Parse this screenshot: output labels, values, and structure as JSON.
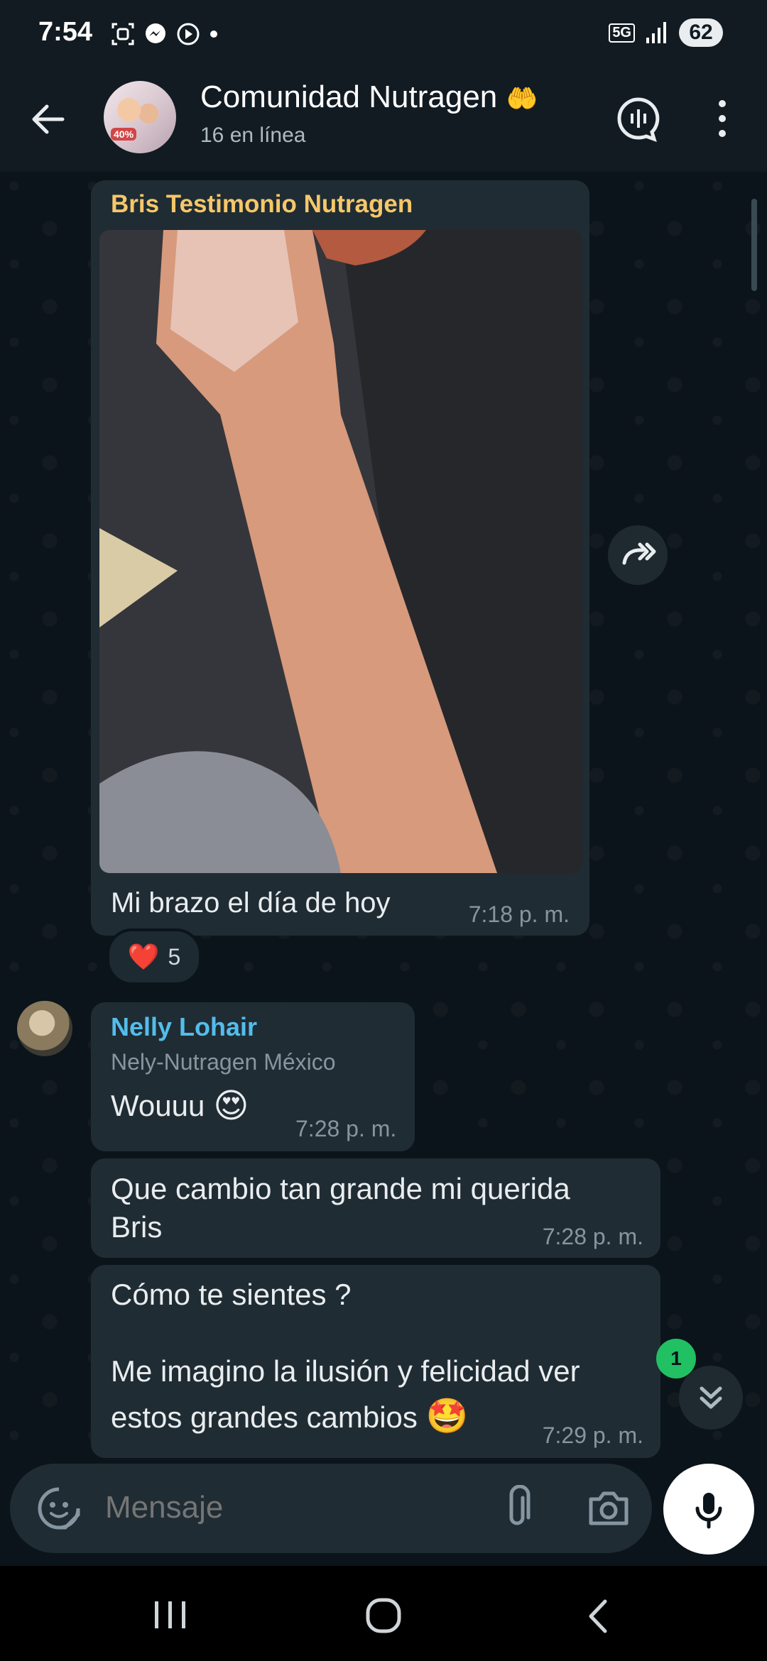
{
  "status_bar": {
    "time": "7:54",
    "network": "5G",
    "battery": "62"
  },
  "header": {
    "title": "Comunidad Nutragen",
    "title_emoji": "🤲",
    "subtitle": "16 en línea",
    "avatar_badge": "40%"
  },
  "messages": [
    {
      "sender": "Bris Testimonio Nutragen",
      "sender_color": "#f6c76a",
      "caption": "Mi brazo el día de hoy",
      "time": "7:18 p. m.",
      "reaction_emoji": "❤️",
      "reaction_count": "5"
    },
    {
      "sender": "Nelly Lohair",
      "sender_color": "#53bdeb",
      "sender_role": "Nely-Nutragen México",
      "text": "Wouuu",
      "emoji": "😍",
      "time": "7:28 p. m."
    },
    {
      "text": "Que cambio tan grande mi querida Bris",
      "time": "7:28 p. m."
    },
    {
      "text_line1": "Cómo te sientes ?",
      "text_line2": "Me imagino la ilusión y felicidad ver estos grandes cambios",
      "emoji": "🤩",
      "time": "7:29 p. m."
    }
  ],
  "unread_count": "1",
  "composer": {
    "placeholder": "Mensaje"
  },
  "colors": {
    "background": "#0b141a",
    "bar": "#121b22",
    "bubble": "#202c33",
    "accent_green": "#21c063"
  }
}
